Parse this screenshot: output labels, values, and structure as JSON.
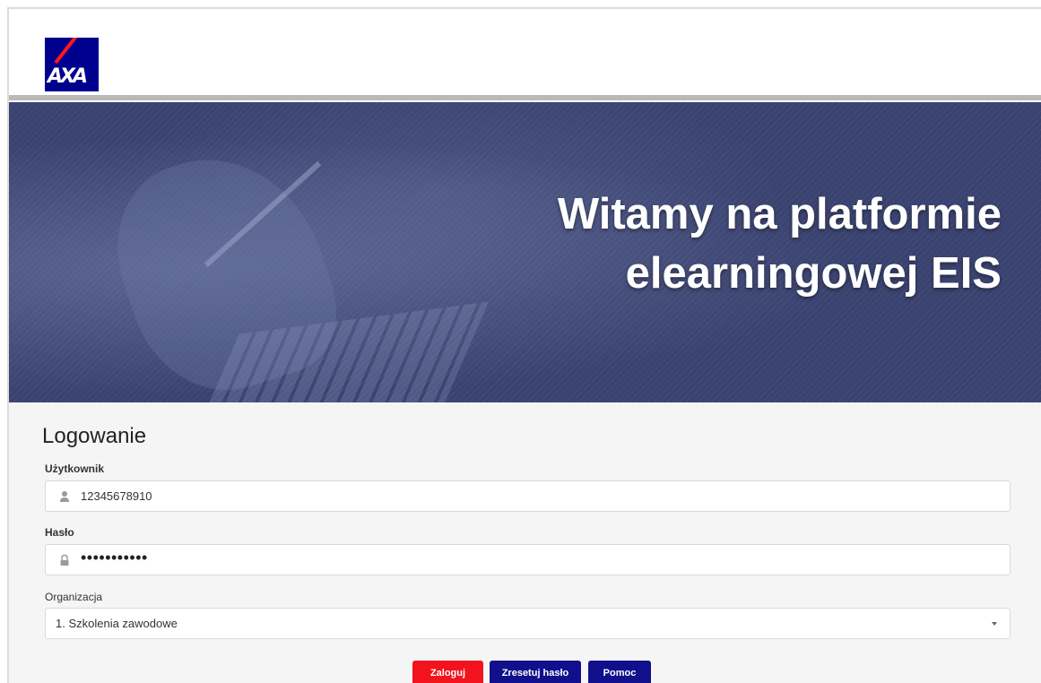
{
  "header": {
    "logo_text": "AXA",
    "brand_colors": {
      "blue": "#00008f",
      "red": "#ff1721"
    }
  },
  "hero": {
    "title_line1": "Witamy na platformie",
    "title_line2": "elearningowej EIS"
  },
  "login": {
    "title": "Logowanie",
    "user": {
      "label": "Użytkownik",
      "value": "12345678910",
      "icon": "user-icon"
    },
    "password": {
      "label": "Hasło",
      "value": "•••••••••••",
      "icon": "lock-icon"
    },
    "organization": {
      "label": "Organizacja",
      "selected": "1. Szkolenia zawodowe"
    },
    "buttons": {
      "login": "Zaloguj",
      "reset": "Zresetuj hasło",
      "help": "Pomoc"
    }
  },
  "colors": {
    "accent_red": "#f2131d",
    "accent_blue": "#10108d",
    "hero_bg": "#3a4370"
  }
}
